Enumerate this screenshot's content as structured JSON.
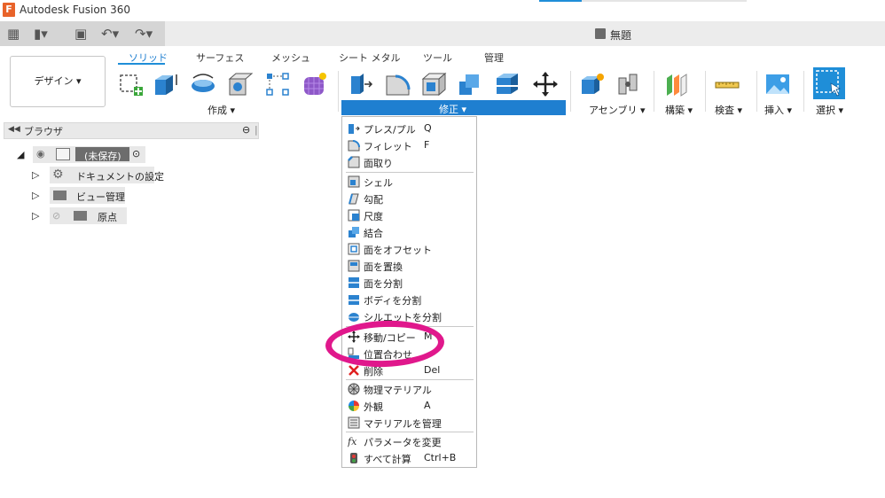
{
  "app": {
    "title": "Autodesk Fusion 360",
    "logo_letter": "F"
  },
  "document": {
    "title": "無題"
  },
  "tabs": [
    "ソリッド",
    "サーフェス",
    "メッシュ",
    "シート メタル",
    "ツール",
    "管理"
  ],
  "workspace": {
    "label": "デザイン ▾"
  },
  "ribbon_groups": {
    "create": "作成 ▾",
    "modify": "修正 ▾",
    "assemble": "アセンブリ ▾",
    "construct": "構築 ▾",
    "inspect": "検査 ▾",
    "insert": "挿入 ▾",
    "select": "選択 ▾"
  },
  "browser": {
    "title": "ブラウザ",
    "root": "(未保存)",
    "items": [
      "ドキュメントの設定",
      "ビュー管理",
      "原点"
    ]
  },
  "modify_menu": {
    "items": [
      {
        "label": "プレス/プル",
        "key": "Q",
        "icon": "press-pull-icon"
      },
      {
        "label": "フィレット",
        "key": "F",
        "icon": "fillet-icon"
      },
      {
        "label": "面取り",
        "key": "",
        "icon": "chamfer-icon"
      },
      {
        "label": "シェル",
        "key": "",
        "icon": "shell-icon"
      },
      {
        "label": "勾配",
        "key": "",
        "icon": "draft-icon"
      },
      {
        "label": "尺度",
        "key": "",
        "icon": "scale-icon"
      },
      {
        "label": "結合",
        "key": "",
        "icon": "combine-icon"
      },
      {
        "label": "面をオフセット",
        "key": "",
        "icon": "offset-face-icon"
      },
      {
        "label": "面を置換",
        "key": "",
        "icon": "replace-face-icon"
      },
      {
        "label": "面を分割",
        "key": "",
        "icon": "split-face-icon"
      },
      {
        "label": "ボディを分割",
        "key": "",
        "icon": "split-body-icon"
      },
      {
        "label": "シルエットを分割",
        "key": "",
        "icon": "silhouette-split-icon"
      },
      {
        "label": "移動/コピー",
        "key": "M",
        "icon": "move-icon"
      },
      {
        "label": "位置合わせ",
        "key": "",
        "icon": "align-icon"
      },
      {
        "label": "削除",
        "key": "Del",
        "icon": "delete-icon"
      },
      {
        "label": "物理マテリアル",
        "key": "",
        "icon": "physical-material-icon"
      },
      {
        "label": "外観",
        "key": "A",
        "icon": "appearance-icon"
      },
      {
        "label": "マテリアルを管理",
        "key": "",
        "icon": "manage-materials-icon"
      },
      {
        "label": "パラメータを変更",
        "key": "",
        "icon": "change-parameters-icon"
      },
      {
        "label": "すべて計算",
        "key": "Ctrl+B",
        "icon": "compute-all-icon"
      }
    ]
  },
  "colors": {
    "accent": "#1f7fd0",
    "highlight_annotation": "#e0188c"
  }
}
